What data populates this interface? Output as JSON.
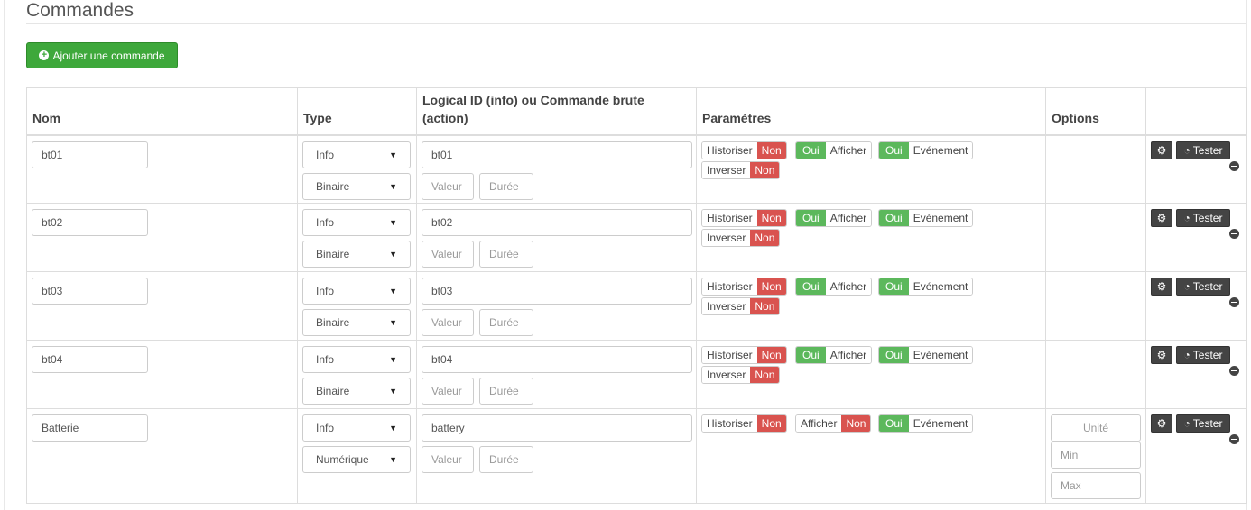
{
  "section": {
    "title": "Commandes",
    "add_button": "Ajouter une commande"
  },
  "table": {
    "headers": {
      "nom": "Nom",
      "type": "Type",
      "logical_id": "Logical ID (info) ou Commande brute (action)",
      "parametres": "Paramètres",
      "options": "Options"
    },
    "rows": [
      {
        "nom": "bt01",
        "type": "Info",
        "subtype": "Binaire",
        "logical_id": "bt01",
        "valeur_ph": "Valeur",
        "duree_ph": "Durée",
        "historiser": "Historiser",
        "historiser_state": "Non",
        "afficher": "Afficher",
        "afficher_state": "Oui",
        "evenement": "Evénement",
        "evenement_state": "Oui",
        "inverser": "Inverser",
        "inverser_state": "Non",
        "tester": "Tester"
      },
      {
        "nom": "bt02",
        "type": "Info",
        "subtype": "Binaire",
        "logical_id": "bt02",
        "valeur_ph": "Valeur",
        "duree_ph": "Durée",
        "historiser": "Historiser",
        "historiser_state": "Non",
        "afficher": "Afficher",
        "afficher_state": "Oui",
        "evenement": "Evénement",
        "evenement_state": "Oui",
        "inverser": "Inverser",
        "inverser_state": "Non",
        "tester": "Tester"
      },
      {
        "nom": "bt03",
        "type": "Info",
        "subtype": "Binaire",
        "logical_id": "bt03",
        "valeur_ph": "Valeur",
        "duree_ph": "Durée",
        "historiser": "Historiser",
        "historiser_state": "Non",
        "afficher": "Afficher",
        "afficher_state": "Oui",
        "evenement": "Evénement",
        "evenement_state": "Oui",
        "inverser": "Inverser",
        "inverser_state": "Non",
        "tester": "Tester"
      },
      {
        "nom": "bt04",
        "type": "Info",
        "subtype": "Binaire",
        "logical_id": "bt04",
        "valeur_ph": "Valeur",
        "duree_ph": "Durée",
        "historiser": "Historiser",
        "historiser_state": "Non",
        "afficher": "Afficher",
        "afficher_state": "Oui",
        "evenement": "Evénement",
        "evenement_state": "Oui",
        "inverser": "Inverser",
        "inverser_state": "Non",
        "tester": "Tester"
      },
      {
        "nom": "Batterie",
        "type": "Info",
        "subtype": "Numérique",
        "logical_id": "battery",
        "valeur_ph": "Valeur",
        "duree_ph": "Durée",
        "historiser": "Historiser",
        "historiser_state": "Non",
        "afficher": "Afficher",
        "afficher_state": "Non",
        "evenement": "Evénement",
        "evenement_state": "Oui",
        "unite_ph": "Unité",
        "min_ph": "Min",
        "max_ph": "Max",
        "tester": "Tester"
      }
    ]
  },
  "colors": {
    "oui": "#5cb85c",
    "non": "#d9534f",
    "add": "#3ea83b",
    "action": "#444444"
  },
  "icons": {
    "add": "plus-circle-icon",
    "config": "cogs-icon",
    "tester": "rss-icon",
    "remove": "minus-circle-icon"
  }
}
